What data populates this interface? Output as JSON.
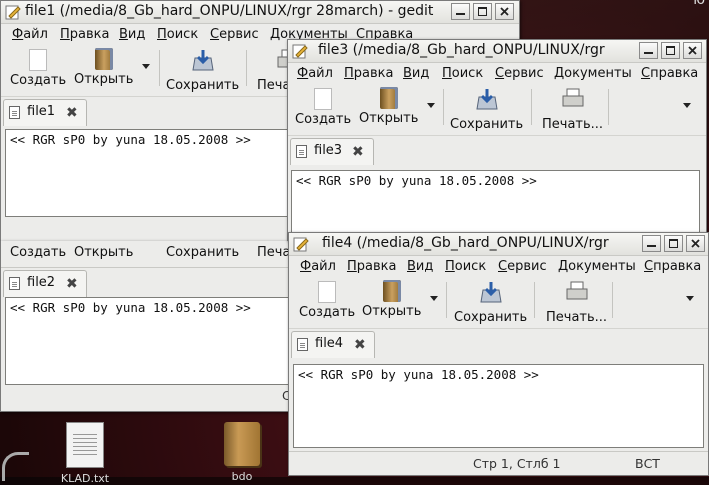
{
  "desktop": {
    "corner_text": "ю",
    "icons": [
      {
        "label": "KLAD.txt"
      },
      {
        "label": "bdo"
      }
    ]
  },
  "window1": {
    "title": "file1 (/media/8_Gb_hard_ONPU/LINUX/rgr 28march) - gedit",
    "menu": [
      "Файл",
      "Правка",
      "Вид",
      "Поиск",
      "Сервис",
      "Документы",
      "Справка"
    ],
    "toolbar": {
      "new": "Создать",
      "open": "Открыть",
      "save": "Сохранить",
      "print": "Печать..."
    },
    "tab": "file1",
    "content": "<< RGR sP0 by yuna 18.05.2008 >>"
  },
  "window2": {
    "toolbar": {
      "new": "Создать",
      "open": "Открыть",
      "save": "Сохранить",
      "print": "Печать..."
    },
    "tab": "file2",
    "content": "<< RGR sP0 by yuna 18.05.2008 >>",
    "status_fragment": "С"
  },
  "window3": {
    "title": "file3 (/media/8_Gb_hard_ONPU/LINUX/rgr",
    "menu": [
      "Файл",
      "Правка",
      "Вид",
      "Поиск",
      "Сервис",
      "Документы",
      "Справка"
    ],
    "toolbar": {
      "new": "Создать",
      "open": "Открыть",
      "save": "Сохранить",
      "print": "Печать..."
    },
    "tab": "file3",
    "content": "<< RGR sP0 by yuna 18.05.2008 >>"
  },
  "window4": {
    "title": "file4 (/media/8_Gb_hard_ONPU/LINUX/rgr",
    "menu": [
      "Файл",
      "Правка",
      "Вид",
      "Поиск",
      "Сервис",
      "Документы",
      "Справка"
    ],
    "toolbar": {
      "new": "Создать",
      "open": "Открыть",
      "save": "Сохранить",
      "print": "Печать..."
    },
    "tab": "file4",
    "content": "<< RGR sP0 by yuna 18.05.2008 >>",
    "status": {
      "position": "Стр 1, Стлб 1",
      "mode": "ВСТ"
    }
  },
  "colors": {
    "window_bg": "#ececea",
    "desktop_bg": "#3a0d12"
  }
}
